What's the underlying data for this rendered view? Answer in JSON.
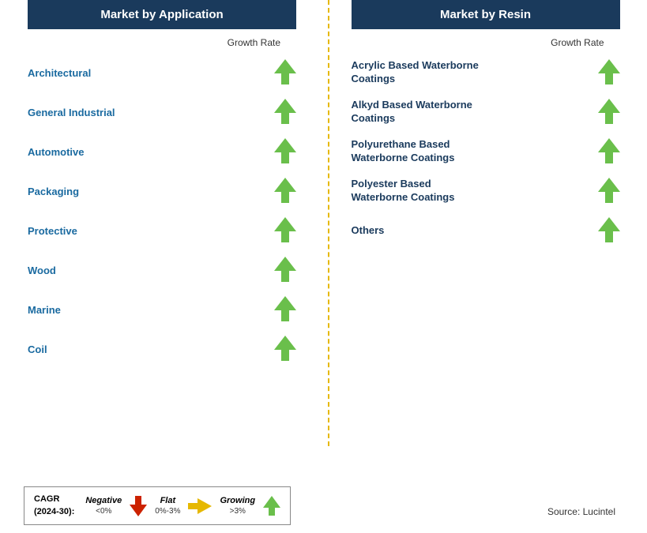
{
  "leftPanel": {
    "header": "Market by Application",
    "growthRateLabel": "Growth Rate",
    "items": [
      {
        "label": "Architectural"
      },
      {
        "label": "General Industrial"
      },
      {
        "label": "Automotive"
      },
      {
        "label": "Packaging"
      },
      {
        "label": "Protective"
      },
      {
        "label": "Wood"
      },
      {
        "label": "Marine"
      },
      {
        "label": "Coil"
      }
    ]
  },
  "rightPanel": {
    "header": "Market by Resin",
    "growthRateLabel": "Growth Rate",
    "items": [
      {
        "label": "Acrylic Based Waterborne\nCoatings"
      },
      {
        "label": "Alkyd Based Waterborne\nCoatings"
      },
      {
        "label": "Polyurethane Based\nWaterborne Coatings"
      },
      {
        "label": "Polyester Based\nWaterborne Coatings"
      },
      {
        "label": "Others"
      }
    ]
  },
  "legend": {
    "cagrLabel": "CAGR\n(2024-30):",
    "negative": "Negative",
    "negativeSub": "<0%",
    "flat": "Flat",
    "flatSub": "0%-3%",
    "growing": "Growing",
    "growingSub": ">3%"
  },
  "source": "Source: Lucintel"
}
